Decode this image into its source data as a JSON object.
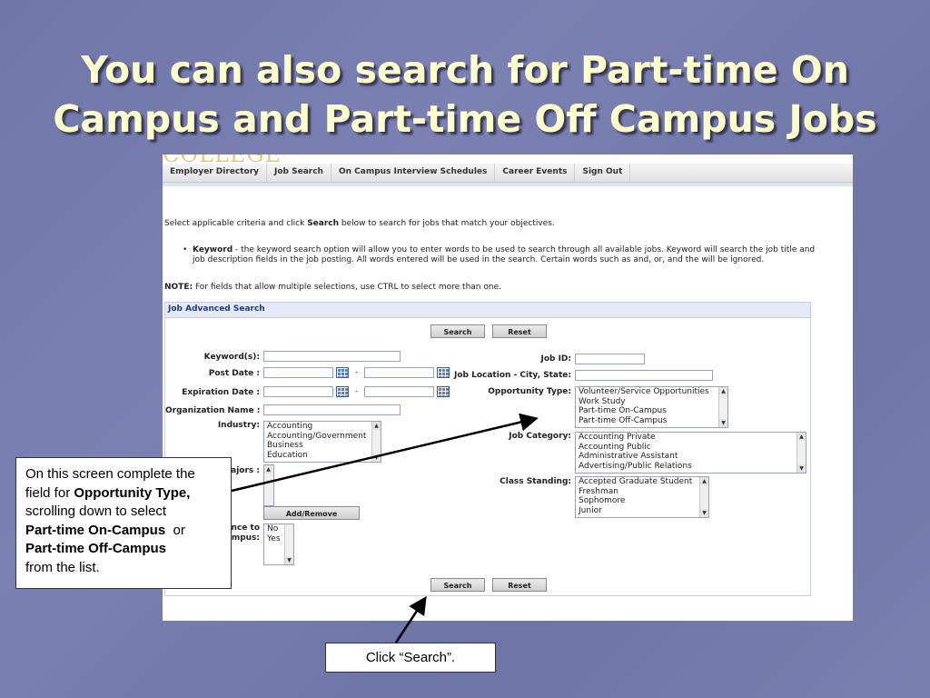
{
  "slide": {
    "title_line1": "You can also search for Part-time On",
    "title_line2": "Campus and Part-time Off Campus Jobs"
  },
  "screen": {
    "logo_fragment": "COLLEGE",
    "nav": [
      "Employer Directory",
      "Job Search",
      "On Campus Interview Schedules",
      "Career Events",
      "Sign Out"
    ],
    "intro_pre": "Select applicable criteria and click ",
    "intro_bold": "Search",
    "intro_post": " below to search for jobs that match your objectives.",
    "bullet_bold": "Keyword",
    "bullet_text": " - the keyword search option will allow you to enter words to be used to search through all available jobs. Keyword will search the job title and job description fields in the job posting. All words entered will be used in the search. Certain words such as and, or, and the will be ignored.",
    "note_bold": "NOTE:",
    "note_text": " For fields that allow multiple selections, use CTRL to select more than one.",
    "panel_title": "Job Advanced Search",
    "search_label": "Search",
    "reset_label": "Reset",
    "labels": {
      "keywords": "Keyword(s):",
      "post_date": "Post Date :",
      "expiration_date": "Expiration Date :",
      "organization_name": "Organization Name :",
      "industry": "Industry:",
      "majors": "ajors :",
      "preference_line1": "nce to",
      "preference_line2": "mpus:",
      "job_id": "Job ID:",
      "job_location": "Job Location - City, State:",
      "opportunity_type": "Opportunity Type:",
      "job_category": "Job Category:",
      "class_standing": "Class Standing:"
    },
    "dash": "-",
    "industry_options": [
      "Accounting",
      "Accounting/Government",
      "Business",
      "Education"
    ],
    "add_remove_label": "Add/Remove",
    "preference_options": [
      "No",
      "Yes"
    ],
    "opportunity_options": [
      "Volunteer/Service Opportunities",
      "Work Study",
      "Part-time On-Campus",
      "Part-time Off-Campus"
    ],
    "category_options": [
      "Accounting Private",
      "Accounting Public",
      "Administrative Assistant",
      "Advertising/Public Relations"
    ],
    "class_options": [
      "Accepted Graduate Student",
      "Freshman",
      "Sophomore",
      "Junior"
    ]
  },
  "callout": {
    "line1": "On this screen complete the",
    "line2_pre": "field for ",
    "line2_bold": "Opportunity Type,",
    "line3": "scrolling down to select",
    "line4_bold": "Part-time On-Campus",
    "line4_post": "  or",
    "line5_bold": "Part-time Off-Campus",
    "line6": "from the list."
  },
  "click_note": "Click “Search”."
}
